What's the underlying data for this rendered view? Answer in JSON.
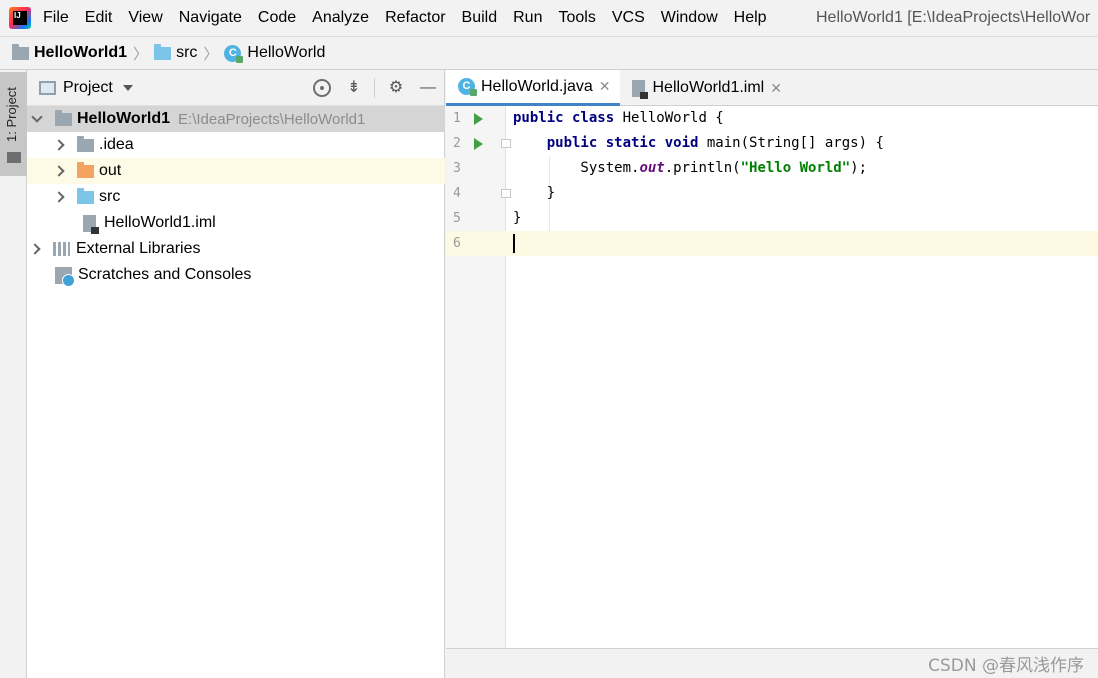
{
  "menubar": {
    "items": [
      "File",
      "Edit",
      "View",
      "Navigate",
      "Code",
      "Analyze",
      "Refactor",
      "Build",
      "Run",
      "Tools",
      "VCS",
      "Window",
      "Help"
    ],
    "window_title": "HelloWorld1 [E:\\IdeaProjects\\HelloWor"
  },
  "breadcrumb": {
    "project": "HelloWorld1",
    "folder": "src",
    "class": "HelloWorld"
  },
  "tool_stripe": {
    "label": "1: Project"
  },
  "project_panel": {
    "title": "Project",
    "tree": [
      {
        "label": "HelloWorld1",
        "path": "E:\\IdeaProjects\\HelloWorld1"
      },
      {
        "label": ".idea"
      },
      {
        "label": "out"
      },
      {
        "label": "src"
      },
      {
        "label": "HelloWorld1.iml"
      },
      {
        "label": "External Libraries"
      },
      {
        "label": "Scratches and Consoles"
      }
    ]
  },
  "editor": {
    "tabs": [
      {
        "label": "HelloWorld.java",
        "active": true
      },
      {
        "label": "HelloWorld1.iml",
        "active": false
      }
    ],
    "lines": [
      {
        "num": "1",
        "text": "public class HelloWorld {"
      },
      {
        "num": "2",
        "text": "    public static void main(String[] args) {"
      },
      {
        "num": "3",
        "text": "        System.out.println(\"Hello World\");"
      },
      {
        "num": "4",
        "text": "    }"
      },
      {
        "num": "5",
        "text": "}"
      },
      {
        "num": "6",
        "text": ""
      }
    ]
  },
  "watermark": "CSDN @春风浅作序",
  "colors": {
    "keyword": "#000080",
    "string": "#008000",
    "field": "#660e7a",
    "selection": "#d5d5d5",
    "current_line": "#fdf9e3",
    "active_tab_underline": "#4083c9"
  }
}
